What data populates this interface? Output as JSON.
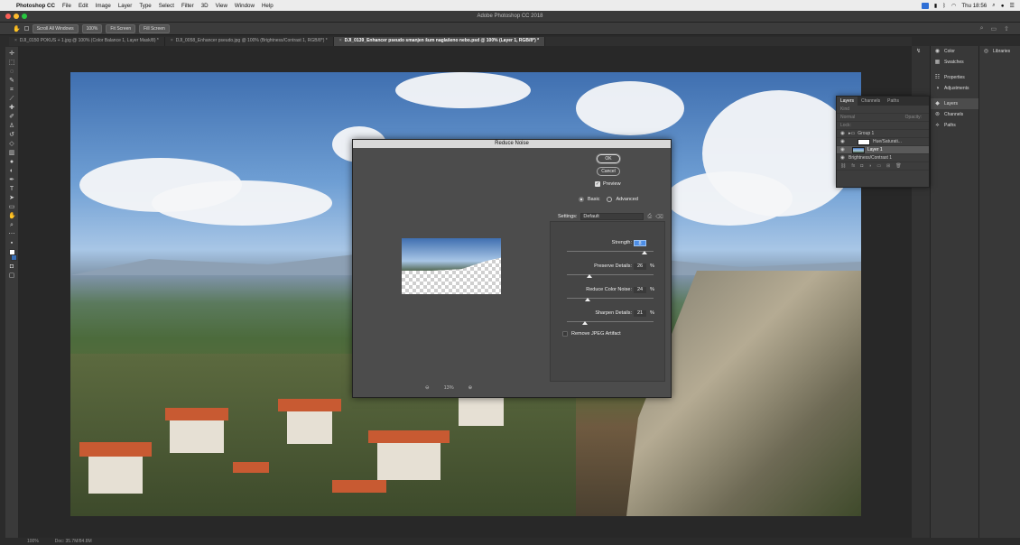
{
  "menubar": {
    "app_name": "Photoshop CC",
    "items": [
      "File",
      "Edit",
      "Image",
      "Layer",
      "Type",
      "Select",
      "Filter",
      "3D",
      "View",
      "Window",
      "Help"
    ],
    "clock": "Thu 18:56"
  },
  "window": {
    "title": "Adobe Photoshop CC 2018"
  },
  "options_bar": {
    "scroll_all": "Scroll All Windows",
    "zoom": "100%",
    "fit_screen": "Fit Screen",
    "fill_screen": "Fill Screen"
  },
  "tabs": [
    {
      "label": "DJI_0150 POKUS + 1.jpg @ 100% (Color Balance 1, Layer Mask/8) *",
      "active": false
    },
    {
      "label": "DJI_0058_Enhancer pseudo.jpg @ 100% (Brightness/Contrast 1, RGB/8*) *",
      "active": false
    },
    {
      "label": "DJI_0139_Enhancer pseudo smanjen šum naglašeno nebo.psd @ 100% (Layer 1, RGB/8*) *",
      "active": true
    }
  ],
  "dialog": {
    "title": "Reduce Noise",
    "ok": "OK",
    "cancel": "Cancel",
    "preview_label": "Preview",
    "preview_checked": true,
    "mode_basic": "Basic",
    "mode_advanced": "Advanced",
    "settings_label": "Settings:",
    "settings_value": "Default",
    "zoom": "13%",
    "params": [
      {
        "label": "Strength:",
        "value": "8",
        "pct": "",
        "fraction": 0.9
      },
      {
        "label": "Preserve Details:",
        "value": "26",
        "pct": "%",
        "fraction": 0.26
      },
      {
        "label": "Reduce Color Noise:",
        "value": "24",
        "pct": "%",
        "fraction": 0.24
      },
      {
        "label": "Sharpen Details:",
        "value": "21",
        "pct": "%",
        "fraction": 0.21
      }
    ],
    "remove_jpeg": "Remove JPEG Artifact"
  },
  "dock": {
    "panels": [
      "Color",
      "Swatches",
      "Properties",
      "Adjustments",
      "Layers",
      "Channels",
      "Paths"
    ],
    "libraries": "Libraries"
  },
  "layers_panel": {
    "tabs": [
      "Layers",
      "Channels",
      "Paths"
    ],
    "kind_placeholder": "Kind",
    "blend_mode": "Normal",
    "opacity_label": "Opacity:",
    "lock_label": "Lock:",
    "rows": [
      {
        "name": "Group 1",
        "selected": false
      },
      {
        "name": "Hue/Saturati...",
        "selected": false
      },
      {
        "name": "Layer 1",
        "selected": true
      },
      {
        "name": "Brightness/Contrast 1",
        "selected": false
      }
    ]
  },
  "status": {
    "zoom": "100%",
    "doc": "Doc: 35.7M/84.8M"
  },
  "colors": {
    "accent": "#4d8ee6",
    "foreground_swatch": "#ffffff",
    "background_swatch": "#3a6fb5"
  }
}
